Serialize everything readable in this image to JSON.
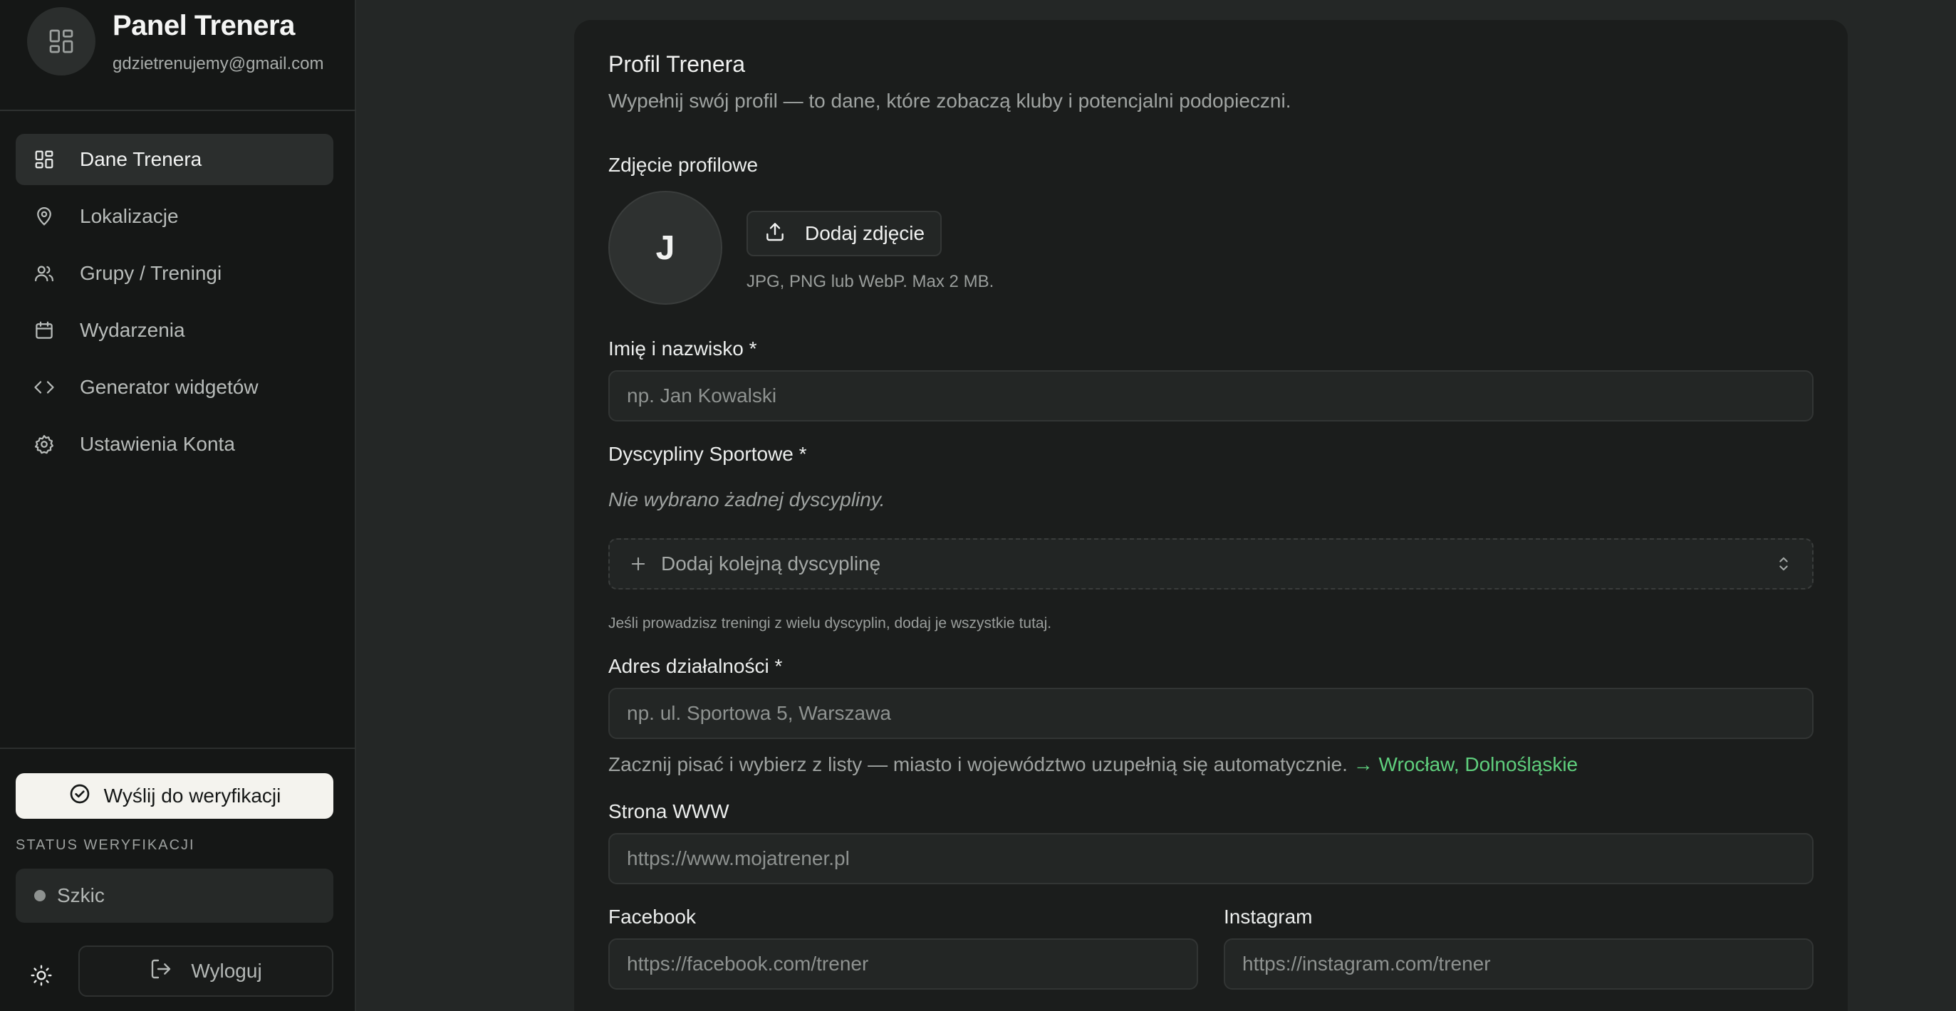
{
  "sidebar": {
    "brand_title": "Panel Trenera",
    "brand_email": "gdzietrenujemy@gmail.com",
    "items": [
      {
        "label": "Dane Trenera",
        "icon": "dashboard-icon",
        "active": true
      },
      {
        "label": "Lokalizacje",
        "icon": "map-pin-icon",
        "active": false
      },
      {
        "label": "Grupy / Treningi",
        "icon": "users-icon",
        "active": false
      },
      {
        "label": "Wydarzenia",
        "icon": "calendar-icon",
        "active": false
      },
      {
        "label": "Generator widgetów",
        "icon": "code-icon",
        "active": false
      },
      {
        "label": "Ustawienia Konta",
        "icon": "gear-icon",
        "active": false
      }
    ],
    "verify_label": "Wyślij do weryfikacji",
    "status_caption": "STATUS WERYFIKACJI",
    "status_value": "Szkic",
    "logout_label": "Wyloguj"
  },
  "profile": {
    "title": "Profil Trenera",
    "subtitle": "Wypełnij swój profil — to dane, które zobaczą kluby i potencjalni podopieczni.",
    "photo_label": "Zdjęcie profilowe",
    "avatar_initial": "J",
    "upload_label": "Dodaj zdjęcie",
    "upload_hint": "JPG, PNG lub WebP. Max 2 MB.",
    "name_label": "Imię i nazwisko *",
    "name_placeholder": "np. Jan Kowalski",
    "name_value": "",
    "disciplines_label": "Dyscypliny Sportowe *",
    "disciplines_empty": "Nie wybrano żadnej dyscypliny.",
    "disciplines_add": "Dodaj kolejną dyscyplinę",
    "disciplines_hint": "Jeśli prowadzisz treningi z wielu dyscyplin, dodaj je wszystkie tutaj.",
    "address_label": "Adres działalności *",
    "address_placeholder": "np. ul. Sportowa 5, Warszawa",
    "address_value": "",
    "address_hint": "Zacznij pisać i wybierz z listy — miasto i województwo uzupełnią się automatycznie.",
    "address_example": "→ Wrocław, Dolnośląskie",
    "www_label": "Strona WWW",
    "www_placeholder": "https://www.mojatrener.pl",
    "www_value": "",
    "facebook_label": "Facebook",
    "facebook_placeholder": "https://facebook.com/trener",
    "facebook_value": "",
    "instagram_label": "Instagram",
    "instagram_placeholder": "https://instagram.com/trener",
    "instagram_value": ""
  },
  "colors": {
    "accent_green": "#5fcf7d",
    "sidebar_bg": "#151716",
    "card_bg": "#1b1d1c",
    "page_bg": "#242726"
  }
}
